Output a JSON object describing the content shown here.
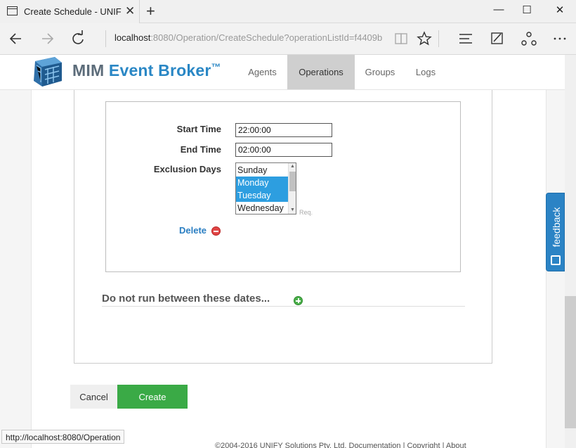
{
  "browser": {
    "tab_title": "Create Schedule - UNIF",
    "tab_close": "✕",
    "new_tab": "+",
    "url_host": "localhost",
    "url_rest": ":8080/Operation/CreateSchedule?operationListId=f4409b",
    "status_url": "http://localhost:8080/Operation"
  },
  "header": {
    "brand_mim": "MIM ",
    "brand_eb": "Event Broker",
    "brand_tm": "™",
    "nav": [
      {
        "label": "Agents",
        "active": false
      },
      {
        "label": "Operations",
        "active": true
      },
      {
        "label": "Groups",
        "active": false
      },
      {
        "label": "Logs",
        "active": false
      }
    ]
  },
  "schedule": {
    "start_label": "Start Time",
    "start_value": "22:00:00",
    "end_label": "End Time",
    "end_value": "02:00:00",
    "exclusion_label": "Exclusion Days",
    "days": [
      {
        "label": "Sunday",
        "selected": false
      },
      {
        "label": "Monday",
        "selected": true
      },
      {
        "label": "Tuesday",
        "selected": true
      },
      {
        "label": "Wednesday",
        "selected": false
      }
    ],
    "req": "Req.",
    "delete_label": "Delete"
  },
  "dates": {
    "heading": "Do not run between these dates..."
  },
  "actions": {
    "cancel": "Cancel",
    "create": "Create"
  },
  "footer": {
    "text": "©2004-2016 UNIFY Solutions Pty. Ltd. Documentation | Copyright | About"
  },
  "feedback": {
    "label": "feedback"
  },
  "colors": {
    "accent": "#2a87c5",
    "create": "#3aaa46",
    "selected": "#2d9ee0"
  }
}
